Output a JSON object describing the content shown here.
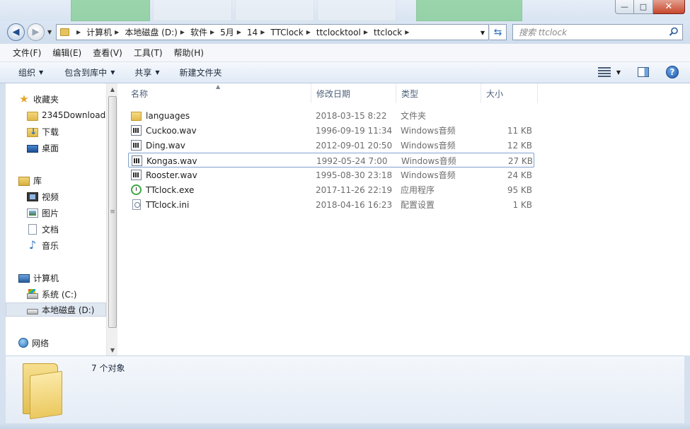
{
  "window": {
    "min_label": "—",
    "max_label": "□",
    "close_label": "✕"
  },
  "address": {
    "crumbs": [
      "计算机",
      "本地磁盘 (D:)",
      "软件",
      "5月",
      "14",
      "TTClock",
      "ttclocktool",
      "ttclock"
    ],
    "search_placeholder": "搜索 ttclock"
  },
  "menu": [
    "文件(F)",
    "编辑(E)",
    "查看(V)",
    "工具(T)",
    "帮助(H)"
  ],
  "toolbar": {
    "organize": "组织",
    "include_library": "包含到库中",
    "share": "共享",
    "new_folder": "新建文件夹"
  },
  "nav": {
    "favorites": "收藏夹",
    "fav_items": [
      "2345Downloads",
      "下载",
      "桌面"
    ],
    "libraries": "库",
    "lib_items": [
      "视频",
      "图片",
      "文档",
      "音乐"
    ],
    "computer": "计算机",
    "drives": [
      "系统 (C:)",
      "本地磁盘 (D:)"
    ],
    "network": "网络"
  },
  "columns": {
    "name": "名称",
    "date": "修改日期",
    "type": "类型",
    "size": "大小"
  },
  "files": [
    {
      "name": "languages",
      "date": "2018-03-15 8:22",
      "type": "文件夹",
      "size": "",
      "icon": "folder-icon"
    },
    {
      "name": "Cuckoo.wav",
      "date": "1996-09-19 11:34",
      "type": "Windows音频",
      "size": "11 KB",
      "icon": "wav-icon"
    },
    {
      "name": "Ding.wav",
      "date": "2012-09-01 20:50",
      "type": "Windows音频",
      "size": "12 KB",
      "icon": "wav-icon"
    },
    {
      "name": "Kongas.wav",
      "date": "1992-05-24 7:00",
      "type": "Windows音频",
      "size": "27 KB",
      "icon": "wav-icon"
    },
    {
      "name": "Rooster.wav",
      "date": "1995-08-30 23:18",
      "type": "Windows音频",
      "size": "24 KB",
      "icon": "wav-icon"
    },
    {
      "name": "TTclock.exe",
      "date": "2017-11-26 22:19",
      "type": "应用程序",
      "size": "95 KB",
      "icon": "clock-app-icon"
    },
    {
      "name": "TTclock.ini",
      "date": "2018-04-16 16:23",
      "type": "配置设置",
      "size": "1 KB",
      "icon": "ini-icon"
    }
  ],
  "details": {
    "count_text": "7 个对象"
  }
}
